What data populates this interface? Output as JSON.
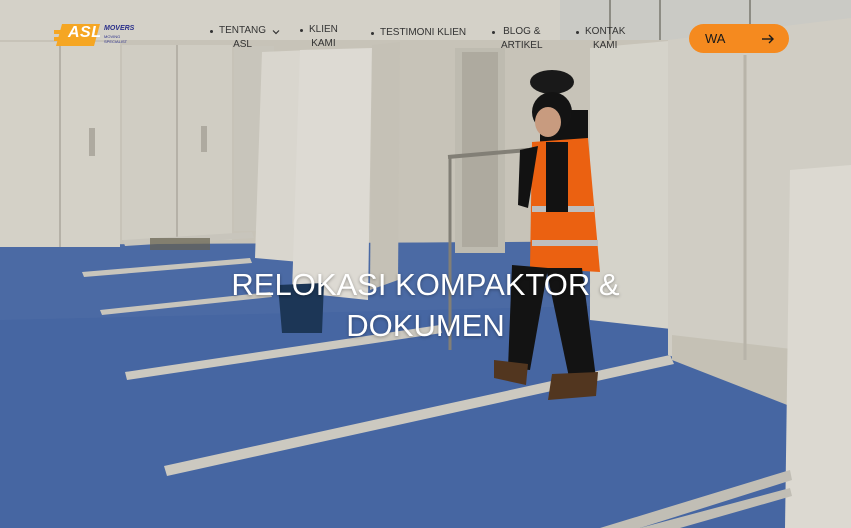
{
  "brand": {
    "logo_text": "ASL",
    "logo_sub": "MOVERS",
    "logo_tagline": "MOVING SPECIALIST",
    "logo_accent": "#f5a623"
  },
  "nav": {
    "items": [
      {
        "label": "TENTANG\nASL",
        "has_dropdown": true
      },
      {
        "label": "KLIEN\nKAMI",
        "has_dropdown": false
      },
      {
        "label": "TESTIMONI KLIEN",
        "has_dropdown": false
      },
      {
        "label": "BLOG &\nARTIKEL",
        "has_dropdown": false
      },
      {
        "label": "KONTAK\nKAMI",
        "has_dropdown": false
      }
    ]
  },
  "cta": {
    "label": "WA",
    "icon": "arrow-right-icon",
    "color": "#f58a1f"
  },
  "hero": {
    "title": "RELOKASI KOMPAKTOR &\nDOKUMEN"
  },
  "colors": {
    "floor": "#4d6fb0",
    "cabinet": "#e9e6dd",
    "vest": "#ff6a13"
  }
}
